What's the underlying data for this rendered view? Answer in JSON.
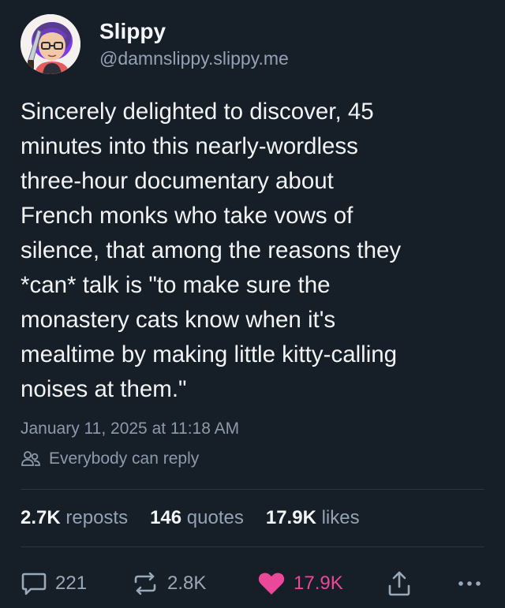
{
  "author": {
    "display_name": "Slippy",
    "handle": "@damnslippy.slippy.me",
    "avatar_icon": "avatar-cartoon-girl-with-glasses"
  },
  "post": {
    "lines": [
      "Sincerely delighted to discover, 45",
      "minutes into this nearly-wordless",
      "three-hour documentary about",
      "French monks who take vows of",
      "silence, that among the reasons they",
      "*can* talk is \"to make sure the",
      "monastery cats know when it's",
      "mealtime by making little kitty-calling",
      "noises at them.\""
    ],
    "timestamp": "January 11, 2025 at 11:18 AM",
    "reply_setting": "Everybody can reply",
    "reply_icon": "people-icon"
  },
  "stats": {
    "reposts_count": "2.7K",
    "reposts_label": "reposts",
    "quotes_count": "146",
    "quotes_label": "quotes",
    "likes_count": "17.9K",
    "likes_label": "likes"
  },
  "actions": {
    "reply": {
      "count": "221",
      "icon": "reply-bubble-icon"
    },
    "repost": {
      "count": "2.8K",
      "icon": "repost-icon"
    },
    "like": {
      "count": "17.9K",
      "icon": "heart-icon",
      "liked": true
    },
    "share": {
      "icon": "share-icon"
    },
    "more": {
      "icon": "more-horizontal-icon"
    }
  },
  "colors": {
    "background": "#161e27",
    "text_primary": "#f1f3f5",
    "text_secondary": "#8c9bac",
    "like_accent": "#ec4899",
    "divider": "#2b3744"
  }
}
